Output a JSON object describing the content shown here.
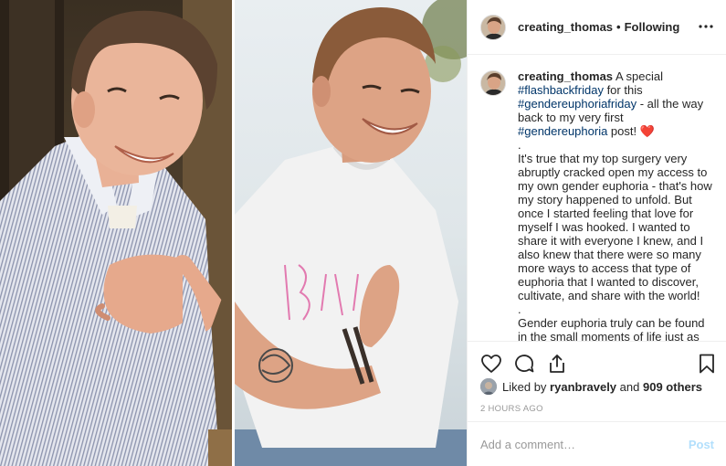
{
  "post": {
    "username": "creating_thomas",
    "follow_status": "Following",
    "caption": {
      "lines_1": [
        "A special "
      ],
      "tag_flashback": "#flashbackfriday",
      "text_for_this": " for this",
      "tag_gender_friday": "#gendereuphoriafriday",
      "text_all_the_way": " - all the way back to my very first ",
      "tag_gender": "#gendereuphoria",
      "text_post": " post! ",
      "heart": "❤️",
      "dot1": ".",
      "paragraph1": "It's true that my top surgery very abruptly cracked open my access to my own gender euphoria - that's how my story happened to unfold. But once I started feeling that love for myself I was hooked. I wanted to share it with everyone I knew, and I also knew that there were so many more ways to access that type of euphoria that I wanted to discover, cultivate, and share with the world!",
      "dot2": ".",
      "paragraph2": "Gender euphoria truly can be found in the small moments of life just as often"
    },
    "likes": {
      "prefix": "Liked by",
      "first_user": "ryanbravely",
      "and": "and",
      "others": "909 others"
    },
    "timestamp": "2 HOURS AGO",
    "comment": {
      "placeholder": "Add a comment…",
      "post_label": "Post"
    }
  },
  "icons": {
    "more": "more-horizontal-icon",
    "like": "heart-outline-icon",
    "comment": "comment-bubble-icon",
    "share": "share-icon",
    "save": "bookmark-icon"
  },
  "colors": {
    "hashtag": "#003569",
    "heart": "#ed4956",
    "post_disabled": "#b2dffc",
    "muted": "#999999"
  }
}
